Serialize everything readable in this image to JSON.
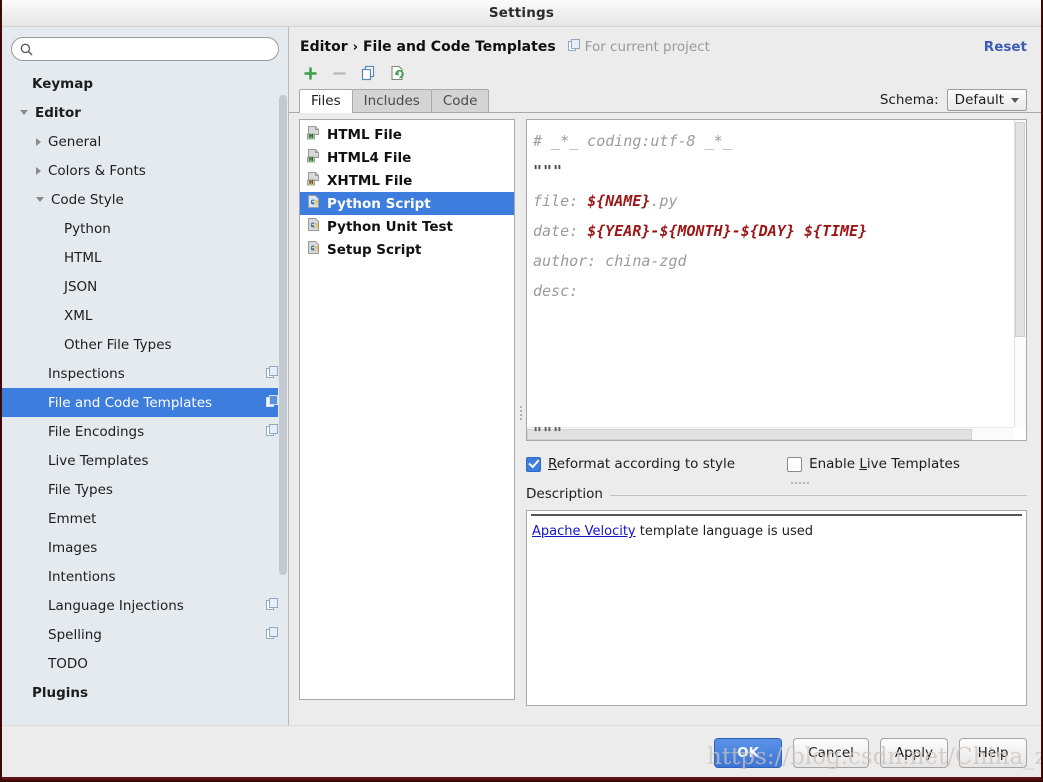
{
  "window": {
    "title": "Settings"
  },
  "search": {
    "value": "",
    "placeholder": "",
    "icon": "search-icon"
  },
  "sidebar": {
    "items": [
      {
        "label": "Keymap",
        "indent": 0,
        "arrow": "none",
        "bold": true,
        "selected": false,
        "project_badge": false
      },
      {
        "label": "Editor",
        "indent": 0,
        "arrow": "expanded",
        "bold": true,
        "selected": false,
        "project_badge": false
      },
      {
        "label": "General",
        "indent": 1,
        "arrow": "collapsed",
        "bold": false,
        "selected": false,
        "project_badge": false
      },
      {
        "label": "Colors & Fonts",
        "indent": 1,
        "arrow": "collapsed",
        "bold": false,
        "selected": false,
        "project_badge": false
      },
      {
        "label": "Code Style",
        "indent": 1,
        "arrow": "expanded",
        "bold": false,
        "selected": false,
        "project_badge": false
      },
      {
        "label": "Python",
        "indent": 2,
        "arrow": "none",
        "bold": false,
        "selected": false,
        "project_badge": false
      },
      {
        "label": "HTML",
        "indent": 2,
        "arrow": "none",
        "bold": false,
        "selected": false,
        "project_badge": false
      },
      {
        "label": "JSON",
        "indent": 2,
        "arrow": "none",
        "bold": false,
        "selected": false,
        "project_badge": false
      },
      {
        "label": "XML",
        "indent": 2,
        "arrow": "none",
        "bold": false,
        "selected": false,
        "project_badge": false
      },
      {
        "label": "Other File Types",
        "indent": 2,
        "arrow": "none",
        "bold": false,
        "selected": false,
        "project_badge": false
      },
      {
        "label": "Inspections",
        "indent": 1,
        "arrow": "none",
        "bold": false,
        "selected": false,
        "project_badge": true
      },
      {
        "label": "File and Code Templates",
        "indent": 1,
        "arrow": "none",
        "bold": false,
        "selected": true,
        "project_badge": true
      },
      {
        "label": "File Encodings",
        "indent": 1,
        "arrow": "none",
        "bold": false,
        "selected": false,
        "project_badge": true
      },
      {
        "label": "Live Templates",
        "indent": 1,
        "arrow": "none",
        "bold": false,
        "selected": false,
        "project_badge": false
      },
      {
        "label": "File Types",
        "indent": 1,
        "arrow": "none",
        "bold": false,
        "selected": false,
        "project_badge": false
      },
      {
        "label": "Emmet",
        "indent": 1,
        "arrow": "none",
        "bold": false,
        "selected": false,
        "project_badge": false
      },
      {
        "label": "Images",
        "indent": 1,
        "arrow": "none",
        "bold": false,
        "selected": false,
        "project_badge": false
      },
      {
        "label": "Intentions",
        "indent": 1,
        "arrow": "none",
        "bold": false,
        "selected": false,
        "project_badge": false
      },
      {
        "label": "Language Injections",
        "indent": 1,
        "arrow": "none",
        "bold": false,
        "selected": false,
        "project_badge": true
      },
      {
        "label": "Spelling",
        "indent": 1,
        "arrow": "none",
        "bold": false,
        "selected": false,
        "project_badge": true
      },
      {
        "label": "TODO",
        "indent": 1,
        "arrow": "none",
        "bold": false,
        "selected": false,
        "project_badge": false
      },
      {
        "label": "Plugins",
        "indent": 0,
        "arrow": "none",
        "bold": true,
        "selected": false,
        "project_badge": false
      }
    ]
  },
  "header": {
    "breadcrumb_parent": "Editor",
    "breadcrumb_sep": "›",
    "breadcrumb_current": "File and Code Templates",
    "for_current_project": "For current project",
    "reset_label": "Reset",
    "schema_label": "Schema:",
    "schema_value": "Default"
  },
  "toolbar": {
    "add_icon": "plus-icon",
    "remove_icon": "minus-icon",
    "copy_icon": "copy-icon",
    "reset_icon": "reset-template-icon"
  },
  "tabs": [
    {
      "label": "Files",
      "active": true
    },
    {
      "label": "Includes",
      "active": false
    },
    {
      "label": "Code",
      "active": false
    }
  ],
  "file_list": [
    {
      "name": "HTML File",
      "icon": "html-file-icon",
      "selected": false
    },
    {
      "name": "HTML4 File",
      "icon": "html4-file-icon",
      "selected": false
    },
    {
      "name": "XHTML File",
      "icon": "xhtml-file-icon",
      "selected": false
    },
    {
      "name": "Python Script",
      "icon": "python-file-icon",
      "selected": true
    },
    {
      "name": "Python Unit Test",
      "icon": "python-file-icon",
      "selected": false
    },
    {
      "name": "Setup Script",
      "icon": "python-file-icon",
      "selected": false
    }
  ],
  "editor": {
    "lines": [
      {
        "segments": [
          {
            "t": "# _*_ coding:utf-8 _*_",
            "k": "txt"
          }
        ]
      },
      {
        "segments": [
          {
            "t": "\"\"\"",
            "k": "q"
          }
        ]
      },
      {
        "segments": [
          {
            "t": "file: ",
            "k": "txt"
          },
          {
            "t": "${NAME}",
            "k": "var"
          },
          {
            "t": ".py",
            "k": "txt"
          }
        ]
      },
      {
        "segments": [
          {
            "t": "date: ",
            "k": "txt"
          },
          {
            "t": "${YEAR}",
            "k": "var"
          },
          {
            "t": "-",
            "k": "dash"
          },
          {
            "t": "${MONTH}",
            "k": "var"
          },
          {
            "t": "-",
            "k": "dash"
          },
          {
            "t": "${DAY}",
            "k": "var"
          },
          {
            "t": " ",
            "k": "txt"
          },
          {
            "t": "${TIME}",
            "k": "var"
          }
        ]
      },
      {
        "segments": [
          {
            "t": "author: china-zgd",
            "k": "txt"
          }
        ]
      },
      {
        "segments": [
          {
            "t": "desc:",
            "k": "txt"
          }
        ]
      }
    ],
    "tail": "\"\"\""
  },
  "options": {
    "reformat": {
      "label_before": "R",
      "label_after": "eformat according to style",
      "checked": true
    },
    "live_templates": {
      "label_before": "Enable ",
      "mnemonic": "L",
      "label_after": "ive Templates",
      "checked": false
    }
  },
  "description": {
    "legend": "Description",
    "link_text": "Apache Velocity",
    "rest_text": " template language is used"
  },
  "footer": {
    "ok": "OK",
    "cancel": "Cancel",
    "apply": "Apply",
    "help": "Help"
  },
  "watermark": {
    "text": "https://blog.csdn.net/China_zgd"
  },
  "colors": {
    "selection_blue": "#3d7ddd",
    "link_blue": "#1414cc",
    "reset_blue": "#3b5bb5",
    "code_var_red": "#9b1717",
    "sidebar_bg": "#e5eaee",
    "dialog_bg": "#ececec"
  }
}
